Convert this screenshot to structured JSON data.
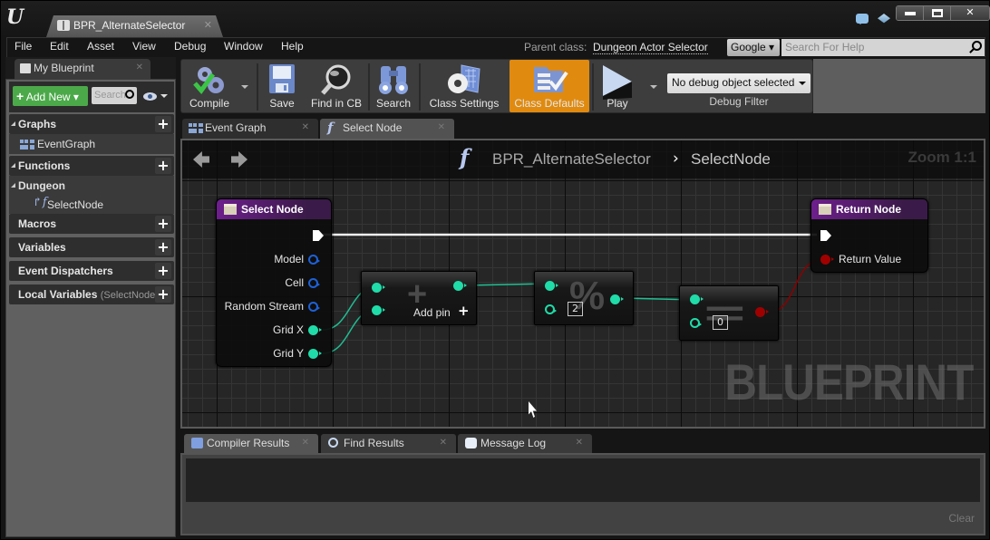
{
  "window": {
    "document_tab": "BPR_AlternateSelector",
    "controls": {
      "minimize": "minimize",
      "maximize": "maximize",
      "close": "✕"
    },
    "title_icons": [
      "chat-icon",
      "tutorial-icon"
    ]
  },
  "menu": {
    "items": [
      "File",
      "Edit",
      "Asset",
      "View",
      "Debug",
      "Window",
      "Help"
    ],
    "parent_class_label": "Parent class:",
    "parent_class_value": "Dungeon Actor Selector",
    "search_provider": "Google",
    "help_search_placeholder": "Search For Help"
  },
  "my_blueprint": {
    "tab_label": "My Blueprint",
    "add_new_label": "Add New",
    "search_placeholder": "Search",
    "sections": {
      "graphs": "Graphs",
      "event_graph": "EventGraph",
      "functions": "Functions",
      "dungeon_category": "Dungeon",
      "select_node": "SelectNode",
      "macros": "Macros",
      "variables": "Variables",
      "event_dispatchers": "Event Dispatchers",
      "local_variables": "Local Variables",
      "local_variables_scope": "(SelectNode)"
    }
  },
  "toolbar": {
    "compile": "Compile",
    "save": "Save",
    "find_in_cb": "Find in CB",
    "search": "Search",
    "class_settings": "Class Settings",
    "class_defaults": "Class Defaults",
    "play": "Play",
    "debug_object": "No debug object selected",
    "debug_filter_label": "Debug Filter",
    "highlight_color": "#e08a0f"
  },
  "graph_tabs": [
    {
      "label": "Event Graph",
      "active": false
    },
    {
      "label": "Select Node",
      "active": true
    }
  ],
  "graph": {
    "breadcrumb_root": "BPR_AlternateSelector",
    "breadcrumb_separator": "›",
    "breadcrumb_current": "SelectNode",
    "zoom_label": "Zoom 1:1",
    "watermark": "BLUEPRINT",
    "select_node": {
      "title": "Select Node",
      "pins": [
        "Model",
        "Cell",
        "Random Stream",
        "Grid X",
        "Grid Y"
      ]
    },
    "add_node": {
      "glyph": "+",
      "add_pin_label": "Add pin"
    },
    "modulo_node": {
      "glyph": "%",
      "divisor": "2"
    },
    "equal_node": {
      "glyph": "==",
      "compare_value": "0"
    },
    "return_node": {
      "title": "Return Node",
      "pins": [
        "Return Value"
      ]
    },
    "pin_colors": {
      "integer": "#1fdca8",
      "struct": "#1e61d8",
      "bool": "#a00000",
      "exec": "#ffffff"
    },
    "header_color": "#6d1f8c"
  },
  "bottom_tabs": [
    {
      "label": "Compiler Results",
      "active": true
    },
    {
      "label": "Find Results",
      "active": false
    },
    {
      "label": "Message Log",
      "active": false
    }
  ],
  "bottom_panel": {
    "clear_label": "Clear"
  }
}
